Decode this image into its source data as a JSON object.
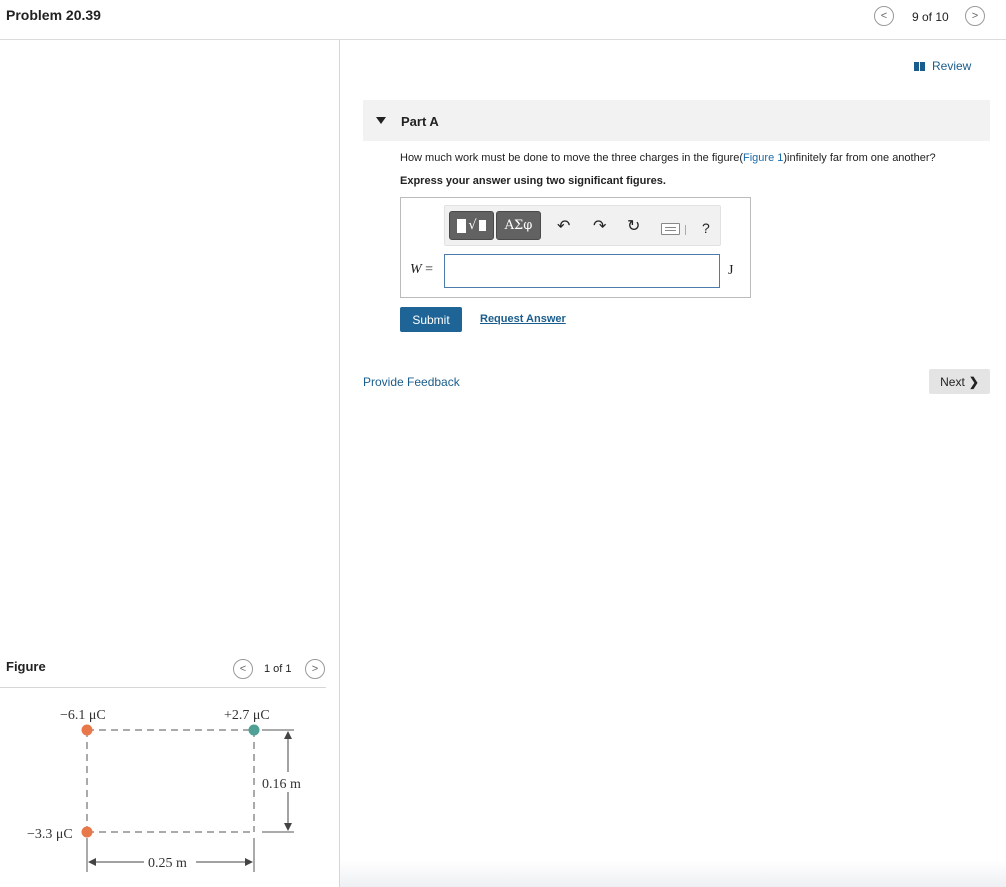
{
  "header": {
    "title": "Problem 20.39",
    "prev_glyph": "<",
    "next_glyph": ">",
    "counter": "9 of 10"
  },
  "review": {
    "label": "Review"
  },
  "part": {
    "label": "Part A",
    "question_before": "How much work must be done to move the three charges in the figure(",
    "figure_link": "Figure 1",
    "question_after": ")infinitely far from one another?",
    "instruction": "Express your answer using two significant figures."
  },
  "toolbar": {
    "template_icon": "templates-icon",
    "greek_label": "ΑΣφ",
    "undo_glyph": "↶",
    "redo_glyph": "↷",
    "reset_glyph": "↻",
    "keyboard_icon": "keyboard-icon",
    "help_label": "?"
  },
  "answer": {
    "variable": "W",
    "equals": "=",
    "value": "",
    "unit": "J"
  },
  "actions": {
    "submit_label": "Submit",
    "request_label": "Request Answer",
    "feedback_label": "Provide Feedback",
    "next_label": "Next"
  },
  "figure": {
    "label": "Figure",
    "counter": "1 of 1",
    "charge_top_left": "−6.1 μC",
    "charge_top_right": "+2.7 μC",
    "charge_bottom_left": "−3.3 μC",
    "height_label": "0.16 m",
    "width_label": "0.25 m"
  },
  "colors": {
    "accent": "#1e6496",
    "link": "#1a5d8c",
    "negative_charge": "#e8784a",
    "positive_charge": "#4fa095"
  }
}
